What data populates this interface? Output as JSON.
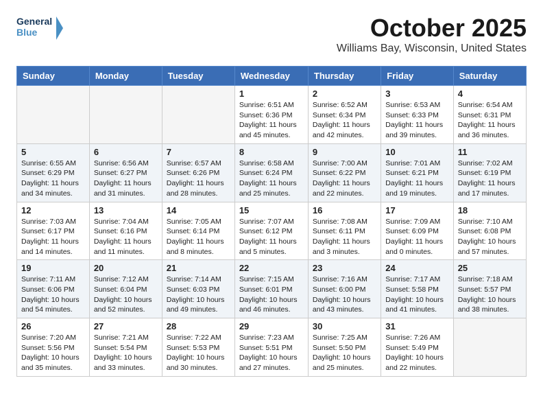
{
  "header": {
    "logo_line1": "General",
    "logo_line2": "Blue",
    "month": "October 2025",
    "location": "Williams Bay, Wisconsin, United States"
  },
  "weekdays": [
    "Sunday",
    "Monday",
    "Tuesday",
    "Wednesday",
    "Thursday",
    "Friday",
    "Saturday"
  ],
  "weeks": [
    [
      {
        "day": "",
        "empty": true
      },
      {
        "day": "",
        "empty": true
      },
      {
        "day": "",
        "empty": true
      },
      {
        "day": "1",
        "sunrise": "6:51 AM",
        "sunset": "6:36 PM",
        "daylight": "11 hours and 45 minutes."
      },
      {
        "day": "2",
        "sunrise": "6:52 AM",
        "sunset": "6:34 PM",
        "daylight": "11 hours and 42 minutes."
      },
      {
        "day": "3",
        "sunrise": "6:53 AM",
        "sunset": "6:33 PM",
        "daylight": "11 hours and 39 minutes."
      },
      {
        "day": "4",
        "sunrise": "6:54 AM",
        "sunset": "6:31 PM",
        "daylight": "11 hours and 36 minutes."
      }
    ],
    [
      {
        "day": "5",
        "sunrise": "6:55 AM",
        "sunset": "6:29 PM",
        "daylight": "11 hours and 34 minutes."
      },
      {
        "day": "6",
        "sunrise": "6:56 AM",
        "sunset": "6:27 PM",
        "daylight": "11 hours and 31 minutes."
      },
      {
        "day": "7",
        "sunrise": "6:57 AM",
        "sunset": "6:26 PM",
        "daylight": "11 hours and 28 minutes."
      },
      {
        "day": "8",
        "sunrise": "6:58 AM",
        "sunset": "6:24 PM",
        "daylight": "11 hours and 25 minutes."
      },
      {
        "day": "9",
        "sunrise": "7:00 AM",
        "sunset": "6:22 PM",
        "daylight": "11 hours and 22 minutes."
      },
      {
        "day": "10",
        "sunrise": "7:01 AM",
        "sunset": "6:21 PM",
        "daylight": "11 hours and 19 minutes."
      },
      {
        "day": "11",
        "sunrise": "7:02 AM",
        "sunset": "6:19 PM",
        "daylight": "11 hours and 17 minutes."
      }
    ],
    [
      {
        "day": "12",
        "sunrise": "7:03 AM",
        "sunset": "6:17 PM",
        "daylight": "11 hours and 14 minutes."
      },
      {
        "day": "13",
        "sunrise": "7:04 AM",
        "sunset": "6:16 PM",
        "daylight": "11 hours and 11 minutes."
      },
      {
        "day": "14",
        "sunrise": "7:05 AM",
        "sunset": "6:14 PM",
        "daylight": "11 hours and 8 minutes."
      },
      {
        "day": "15",
        "sunrise": "7:07 AM",
        "sunset": "6:12 PM",
        "daylight": "11 hours and 5 minutes."
      },
      {
        "day": "16",
        "sunrise": "7:08 AM",
        "sunset": "6:11 PM",
        "daylight": "11 hours and 3 minutes."
      },
      {
        "day": "17",
        "sunrise": "7:09 AM",
        "sunset": "6:09 PM",
        "daylight": "11 hours and 0 minutes."
      },
      {
        "day": "18",
        "sunrise": "7:10 AM",
        "sunset": "6:08 PM",
        "daylight": "10 hours and 57 minutes."
      }
    ],
    [
      {
        "day": "19",
        "sunrise": "7:11 AM",
        "sunset": "6:06 PM",
        "daylight": "10 hours and 54 minutes."
      },
      {
        "day": "20",
        "sunrise": "7:12 AM",
        "sunset": "6:04 PM",
        "daylight": "10 hours and 52 minutes."
      },
      {
        "day": "21",
        "sunrise": "7:14 AM",
        "sunset": "6:03 PM",
        "daylight": "10 hours and 49 minutes."
      },
      {
        "day": "22",
        "sunrise": "7:15 AM",
        "sunset": "6:01 PM",
        "daylight": "10 hours and 46 minutes."
      },
      {
        "day": "23",
        "sunrise": "7:16 AM",
        "sunset": "6:00 PM",
        "daylight": "10 hours and 43 minutes."
      },
      {
        "day": "24",
        "sunrise": "7:17 AM",
        "sunset": "5:58 PM",
        "daylight": "10 hours and 41 minutes."
      },
      {
        "day": "25",
        "sunrise": "7:18 AM",
        "sunset": "5:57 PM",
        "daylight": "10 hours and 38 minutes."
      }
    ],
    [
      {
        "day": "26",
        "sunrise": "7:20 AM",
        "sunset": "5:56 PM",
        "daylight": "10 hours and 35 minutes."
      },
      {
        "day": "27",
        "sunrise": "7:21 AM",
        "sunset": "5:54 PM",
        "daylight": "10 hours and 33 minutes."
      },
      {
        "day": "28",
        "sunrise": "7:22 AM",
        "sunset": "5:53 PM",
        "daylight": "10 hours and 30 minutes."
      },
      {
        "day": "29",
        "sunrise": "7:23 AM",
        "sunset": "5:51 PM",
        "daylight": "10 hours and 27 minutes."
      },
      {
        "day": "30",
        "sunrise": "7:25 AM",
        "sunset": "5:50 PM",
        "daylight": "10 hours and 25 minutes."
      },
      {
        "day": "31",
        "sunrise": "7:26 AM",
        "sunset": "5:49 PM",
        "daylight": "10 hours and 22 minutes."
      },
      {
        "day": "",
        "empty": true
      }
    ]
  ],
  "labels": {
    "sunrise": "Sunrise:",
    "sunset": "Sunset:",
    "daylight": "Daylight:"
  }
}
